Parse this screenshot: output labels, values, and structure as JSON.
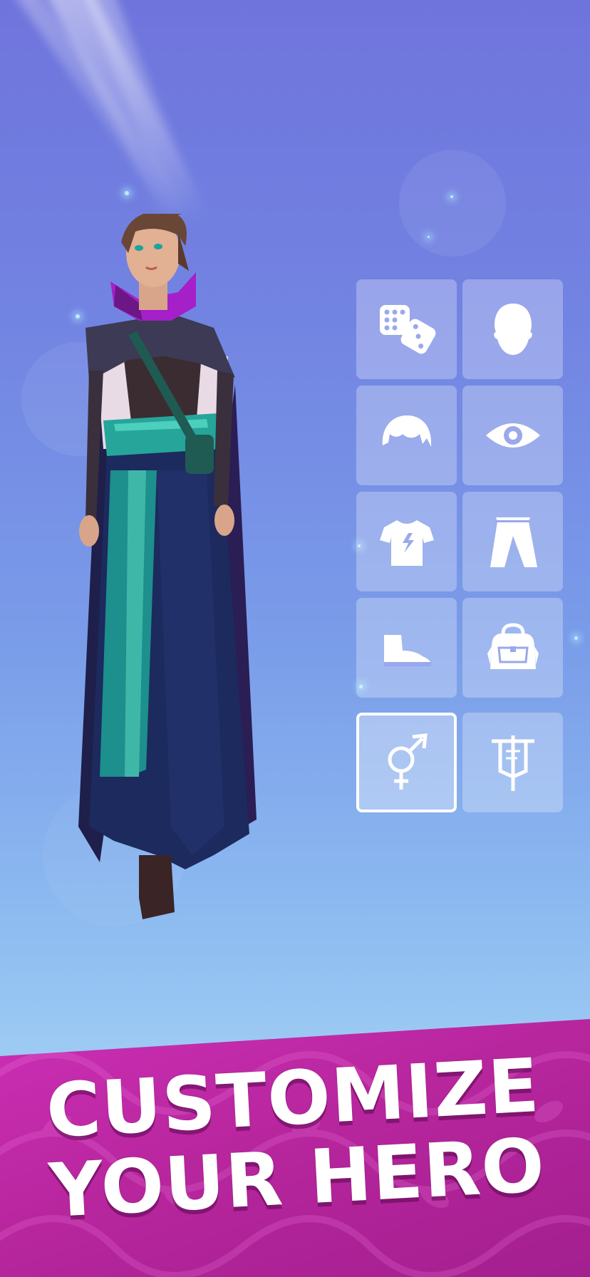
{
  "banner": {
    "line1": "CUSTOMIZE",
    "line2": "YOUR HERO"
  },
  "colors": {
    "banner": "#b8269e",
    "sky_top": "#6f74dc",
    "sky_bottom": "#a5d0f4",
    "tile": "rgba(255,255,255,0.28)",
    "selected_border": "#ffffff"
  },
  "options": [
    {
      "icon": "dice-icon",
      "selected": false
    },
    {
      "icon": "head-icon",
      "selected": false
    },
    {
      "icon": "hair-icon",
      "selected": false
    },
    {
      "icon": "eye-icon",
      "selected": false
    },
    {
      "icon": "shirt-icon",
      "selected": false
    },
    {
      "icon": "pants-icon",
      "selected": false
    },
    {
      "icon": "boot-icon",
      "selected": false
    },
    {
      "icon": "bag-icon",
      "selected": false
    },
    {
      "icon": "gender-icon",
      "selected": true
    },
    {
      "icon": "banner-flag-icon",
      "selected": false
    }
  ]
}
